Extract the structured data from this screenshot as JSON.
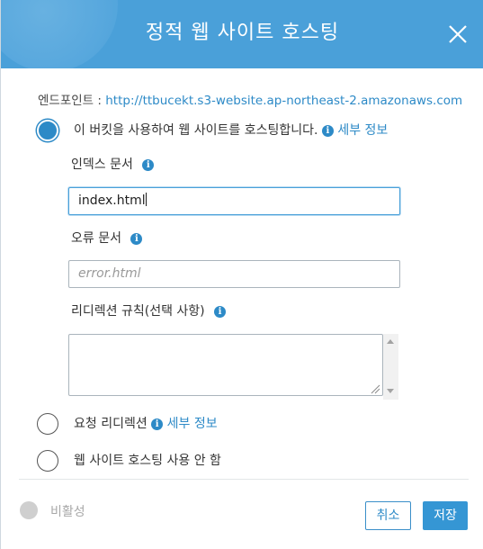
{
  "dialog": {
    "title": "정적 웹 사이트 호스팅"
  },
  "endpoint": {
    "label": "엔드포인트 : ",
    "url": "http://ttbucekt.s3-website.ap-northeast-2.amazonaws.com"
  },
  "options": [
    {
      "label": "이 버킷을 사용하여 웹 사이트를 호스팅합니다.",
      "link": "세부 정보",
      "selected": true
    },
    {
      "label": "요청 리디렉션",
      "link": "세부 정보",
      "selected": false
    },
    {
      "label": "웹 사이트 호스팅 사용 안 함",
      "selected": false
    }
  ],
  "fields": {
    "index_label": "인덱스 문서",
    "index_value": "index.html",
    "error_label": "오류 문서",
    "error_placeholder": "error.html",
    "redirect_label": "리디렉션 규칙(선택 사항)",
    "redirect_value": ""
  },
  "footer": {
    "status": "비활성",
    "cancel": "취소",
    "save": "저장"
  },
  "icons": {
    "info": "i"
  },
  "colors": {
    "header": "#4aa0d9",
    "accent": "#2d8ac7",
    "save_button": "#3596d4"
  }
}
